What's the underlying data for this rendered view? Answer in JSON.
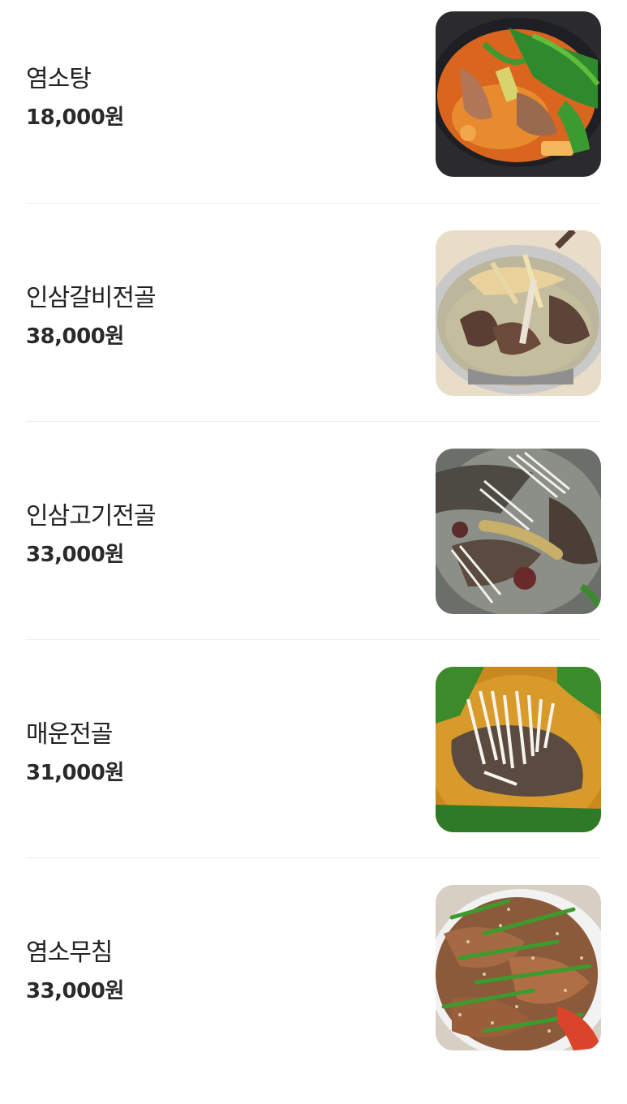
{
  "menu": {
    "items": [
      {
        "name": "염소탕",
        "price": "18,000원",
        "photo_icon": "goat-stew-photo"
      },
      {
        "name": "인삼갈비전골",
        "price": "38,000원",
        "photo_icon": "ginseng-rib-hotpot-photo"
      },
      {
        "name": "인삼고기전골",
        "price": "33,000원",
        "photo_icon": "ginseng-meat-hotpot-photo"
      },
      {
        "name": "매운전골",
        "price": "31,000원",
        "photo_icon": "spicy-hotpot-photo"
      },
      {
        "name": "염소무침",
        "price": "33,000원",
        "photo_icon": "seasoned-goat-salad-photo"
      }
    ]
  }
}
